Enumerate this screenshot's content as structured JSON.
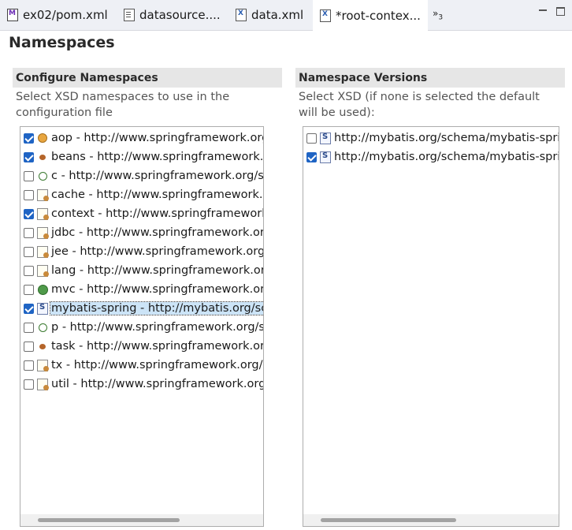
{
  "tabs": [
    {
      "label": "ex02/pom.xml",
      "icon": "maven-file-icon"
    },
    {
      "label": "datasource....",
      "icon": "document-icon"
    },
    {
      "label": "data.xml",
      "icon": "xml-file-icon"
    },
    {
      "label": "*root-contex...",
      "icon": "xml-file-icon",
      "active": true
    }
  ],
  "tab_overflow": {
    "glyph": "»",
    "count": "3"
  },
  "page_title": "Namespaces",
  "left": {
    "header": "Configure Namespaces",
    "description": "Select XSD namespaces to use in the configuration file",
    "items": [
      {
        "label": "aop - http://www.springframework.org/",
        "checked": true,
        "icon": "aop"
      },
      {
        "label": "beans - http://www.springframework.or",
        "checked": true,
        "icon": "bean"
      },
      {
        "label": "c - http://www.springframework.org/sch",
        "checked": false,
        "icon": "pc"
      },
      {
        "label": "cache - http://www.springframework.or",
        "checked": false,
        "icon": "file"
      },
      {
        "label": "context - http://www.springframework.",
        "checked": true,
        "icon": "file"
      },
      {
        "label": "jdbc - http://www.springframework.org",
        "checked": false,
        "icon": "file"
      },
      {
        "label": "jee - http://www.springframework.org/s",
        "checked": false,
        "icon": "file"
      },
      {
        "label": "lang - http://www.springframework.org",
        "checked": false,
        "icon": "file"
      },
      {
        "label": "mvc - http://www.springframework.org,",
        "checked": false,
        "icon": "globe"
      },
      {
        "label": "mybatis-spring - http://mybatis.org/sch",
        "checked": true,
        "icon": "s",
        "selected": true
      },
      {
        "label": "p - http://www.springframework.org/sc",
        "checked": false,
        "icon": "pc"
      },
      {
        "label": "task - http://www.springframework.org,",
        "checked": false,
        "icon": "bean"
      },
      {
        "label": "tx - http://www.springframework.org/sc",
        "checked": false,
        "icon": "file"
      },
      {
        "label": "util - http://www.springframework.org/",
        "checked": false,
        "icon": "file"
      }
    ]
  },
  "right": {
    "header": "Namespace Versions",
    "description": "Select XSD (if none is selected the default will be used):",
    "items": [
      {
        "label": "http://mybatis.org/schema/mybatis-spring",
        "checked": false,
        "icon": "s"
      },
      {
        "label": "http://mybatis.org/schema/mybatis-spring",
        "checked": true,
        "icon": "s"
      }
    ]
  }
}
